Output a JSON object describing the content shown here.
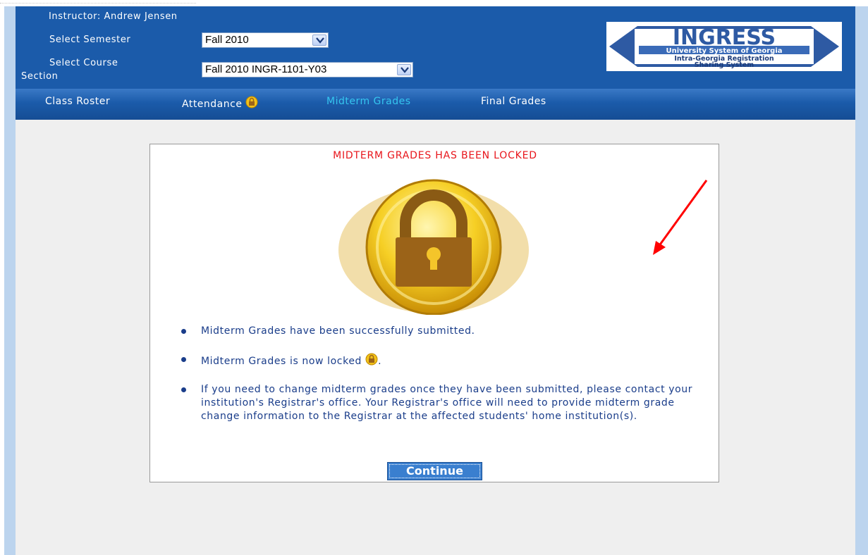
{
  "header": {
    "instructor_label": "Instructor: Andrew Jensen",
    "semester_label": "Select Semester",
    "semester_value": "Fall 2010",
    "course_label_line1": "Select Course",
    "course_label_line2": "Section",
    "course_value": "Fall 2010 INGR-1101-Y03",
    "logo": {
      "title": "INGRESS",
      "line1": "University System of Georgia",
      "line2": "Intra-Georgia Registration",
      "line3": "Sharing System"
    }
  },
  "nav": {
    "items": [
      {
        "label": "Class Roster"
      },
      {
        "label": "Attendance"
      },
      {
        "label": "Midterm Grades",
        "active": true
      },
      {
        "label": "Final Grades"
      }
    ]
  },
  "panel": {
    "title": "MIDTERM GRADES HAS BEEN LOCKED",
    "bullets": [
      "Midterm Grades have been successfully submitted.",
      "Midterm Grades is now locked",
      "If you need to change midterm grades once they have been submitted, please contact your institution's Registrar's office. Your Registrar's office will need to provide midterm grade change information to the Registrar at the affected students' home institution(s)."
    ],
    "bullet2_suffix": ".",
    "continue_label": "Continue"
  },
  "colors": {
    "header_blue": "#1b5baa",
    "active_tab": "#35c6ef",
    "alert_red": "#e8151b",
    "text_blue": "#1a3d8a",
    "button_blue": "#3a7fcf"
  },
  "icons": [
    "lock-badge-icon",
    "chevron-down-icon",
    "padlock-icon",
    "red-arrow-annotation"
  ]
}
